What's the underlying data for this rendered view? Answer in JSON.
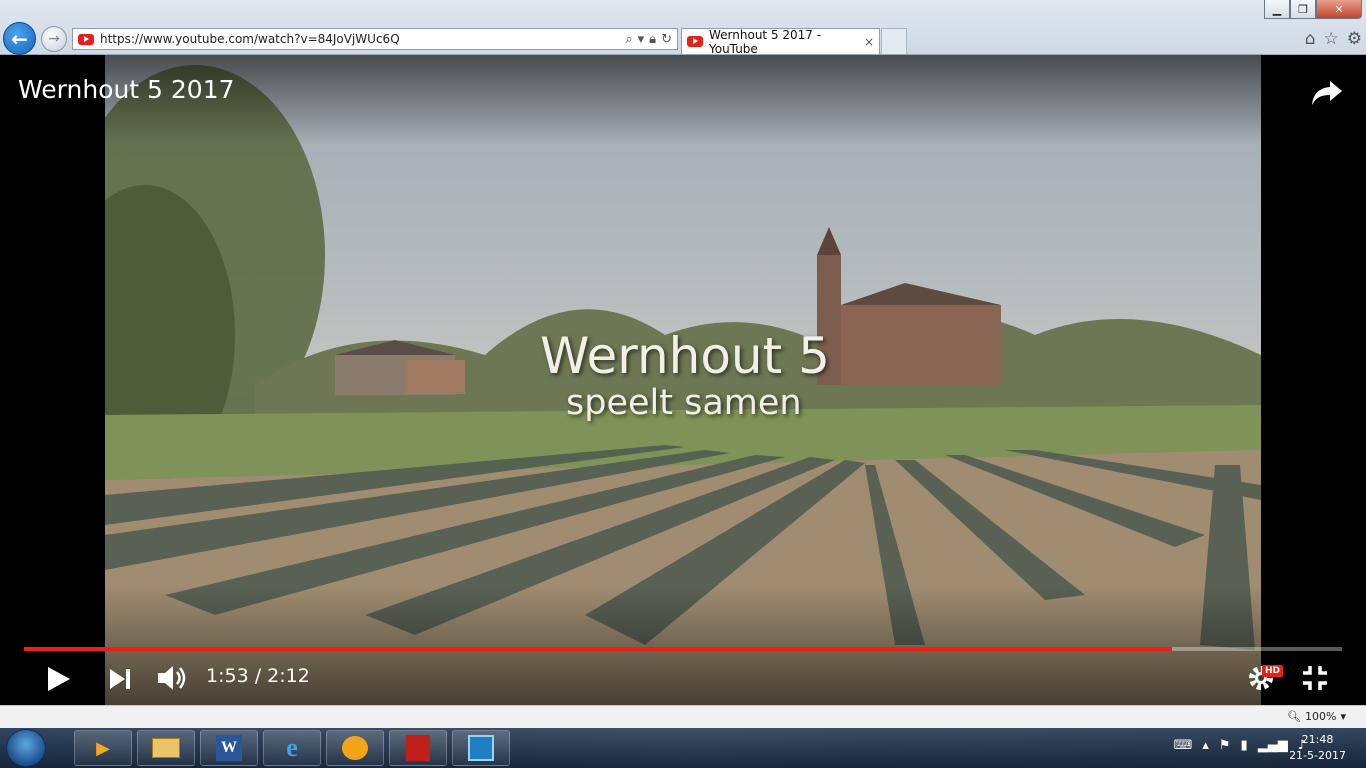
{
  "browser": {
    "url": "https://www.youtube.com/watch?v=84JoVjWUc6Q",
    "tab_title": "Wernhout 5 2017 - YouTube",
    "tab_close": "×",
    "window_controls": {
      "minimize": "▁",
      "maximize": "❐",
      "close": "✕"
    },
    "icons": [
      "back-icon",
      "forward-icon",
      "search-icon",
      "lock-icon",
      "refresh-icon",
      "home-icon",
      "favorites-star-icon",
      "settings-gear-icon"
    ]
  },
  "video": {
    "title": "Wernhout 5 2017",
    "overlay_title": "Wernhout 5",
    "overlay_subtitle": "speelt samen",
    "time_display": "1:53 / 2:12",
    "progress_fraction": 0.8712,
    "hd_badge": "HD"
  },
  "status_bar": {
    "zoom": "100%"
  },
  "taskbar": {
    "apps": [
      "windows-media-player-icon",
      "file-explorer-icon",
      "word-icon",
      "internet-explorer-icon",
      "outlook-icon",
      "acrobat-icon",
      "lync-icon"
    ],
    "time": "21:48",
    "date": "21-5-2017"
  },
  "colors": {
    "progress": "#e62117",
    "accent_blue": "#1463b8"
  }
}
